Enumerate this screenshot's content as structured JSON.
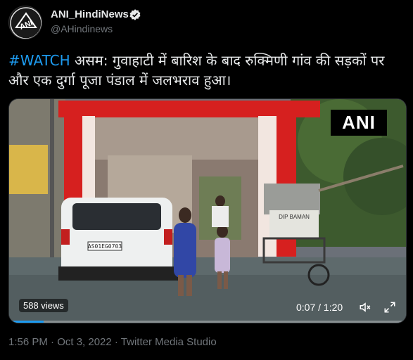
{
  "account": {
    "display_name": "ANI_HindiNews",
    "handle": "@AHindinews",
    "avatar_text": "ANI"
  },
  "tweet": {
    "hashtag": "#WATCH",
    "text": " असम: गुवाहाटी में बारिश के बाद रुक्मिणी गांव की सड़कों पर और एक दुर्गा पूजा पंडाल में जलभराव हुआ।"
  },
  "video": {
    "watermark": "ANI",
    "views": "588 views",
    "current_time": "0:07",
    "duration": "1:20",
    "time_display": "0:07 / 1:20",
    "progress_fraction": 0.0875,
    "scene_text": {
      "plate": "AS01EG0703",
      "cart_sign": "DIP BAMAN"
    }
  },
  "footer": {
    "meta": "1:56 PM · Oct 3, 2022 · Twitter Media Studio"
  },
  "colors": {
    "accent": "#1d9bf0",
    "text": "#e7e9ea",
    "muted": "#71767b",
    "background": "#000000"
  }
}
